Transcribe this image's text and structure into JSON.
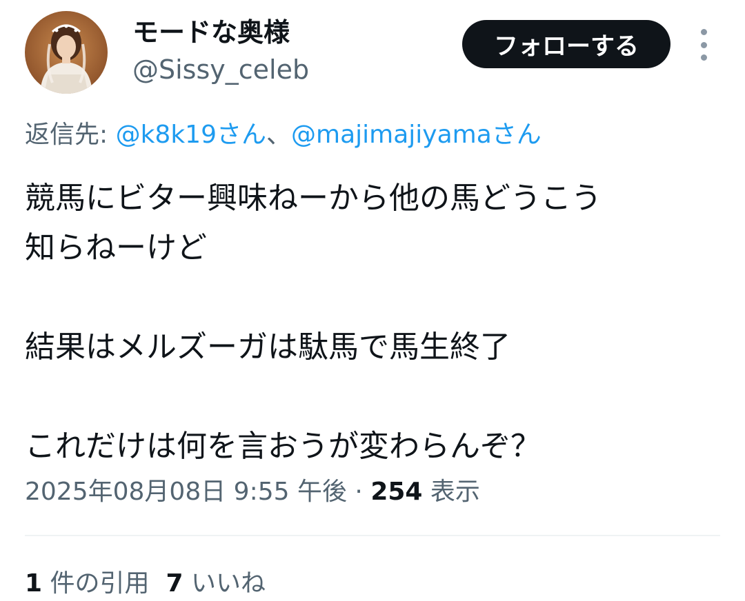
{
  "profile": {
    "display_name": "モードな奥様",
    "handle": "@Sissy_celeb",
    "avatar_icon": "portrait-avatar"
  },
  "header": {
    "follow_label": "フォローする",
    "more_icon": "vertical-ellipsis-icon"
  },
  "reply": {
    "prefix": "返信先: ",
    "mention1": "@k8k19さん",
    "separator": "、",
    "mention2": "@majimajiyamaさん"
  },
  "tweet": {
    "text": "競馬にビター興味ねーから他の馬どうこう\n知らねーけど\n\n結果はメルズーガは駄馬で馬生終了\n\nこれだけは何を言おうが変わらんぞ？"
  },
  "meta": {
    "timestamp": "2025年08月08日 9:55 午後",
    "separator": " · ",
    "views_count": "254",
    "views_label": " 表示"
  },
  "stats": {
    "quotes_count": "1",
    "quotes_label": " 件の引用",
    "likes_count": "7",
    "likes_label": " いいね"
  },
  "colors": {
    "text": "#0f1419",
    "secondary": "#536471",
    "link": "#1d9bf0",
    "button": "#0f1419"
  }
}
